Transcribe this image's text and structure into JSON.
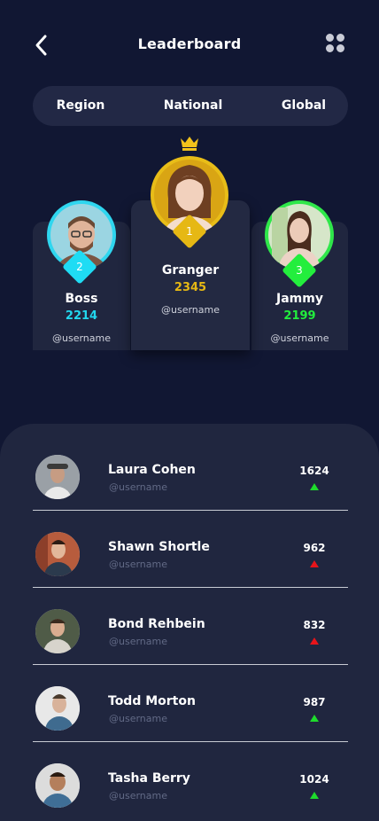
{
  "header": {
    "title": "Leaderboard",
    "back_icon": "chevron-left-icon",
    "menu_icon": "grid-dots-icon"
  },
  "tabs": [
    {
      "label": "Region"
    },
    {
      "label": "National"
    },
    {
      "label": "Global"
    }
  ],
  "podium": [
    {
      "rank": "2",
      "name": "Boss",
      "score": "2214",
      "username": "@username",
      "color": "#1fdcf4"
    },
    {
      "rank": "1",
      "name": "Granger",
      "score": "2345",
      "username": "@username",
      "color": "#e6b814"
    },
    {
      "rank": "3",
      "name": "Jammy",
      "score": "2199",
      "username": "@username",
      "color": "#23ee3d"
    }
  ],
  "list": [
    {
      "name": "Laura Cohen",
      "username": "@username",
      "score": "1624",
      "trend": "up"
    },
    {
      "name": "Shawn Shortle",
      "username": "@username",
      "score": "962",
      "trend": "down"
    },
    {
      "name": "Bond Rehbein",
      "username": "@username",
      "score": "832",
      "trend": "down"
    },
    {
      "name": "Todd Morton",
      "username": "@username",
      "score": "987",
      "trend": "up"
    },
    {
      "name": "Tasha Berry",
      "username": "@username",
      "score": "1024",
      "trend": "up"
    }
  ],
  "colors": {
    "background": "#111733",
    "panel": "#20263f",
    "trend_up": "#1edb2c",
    "trend_down": "#e8141a"
  }
}
